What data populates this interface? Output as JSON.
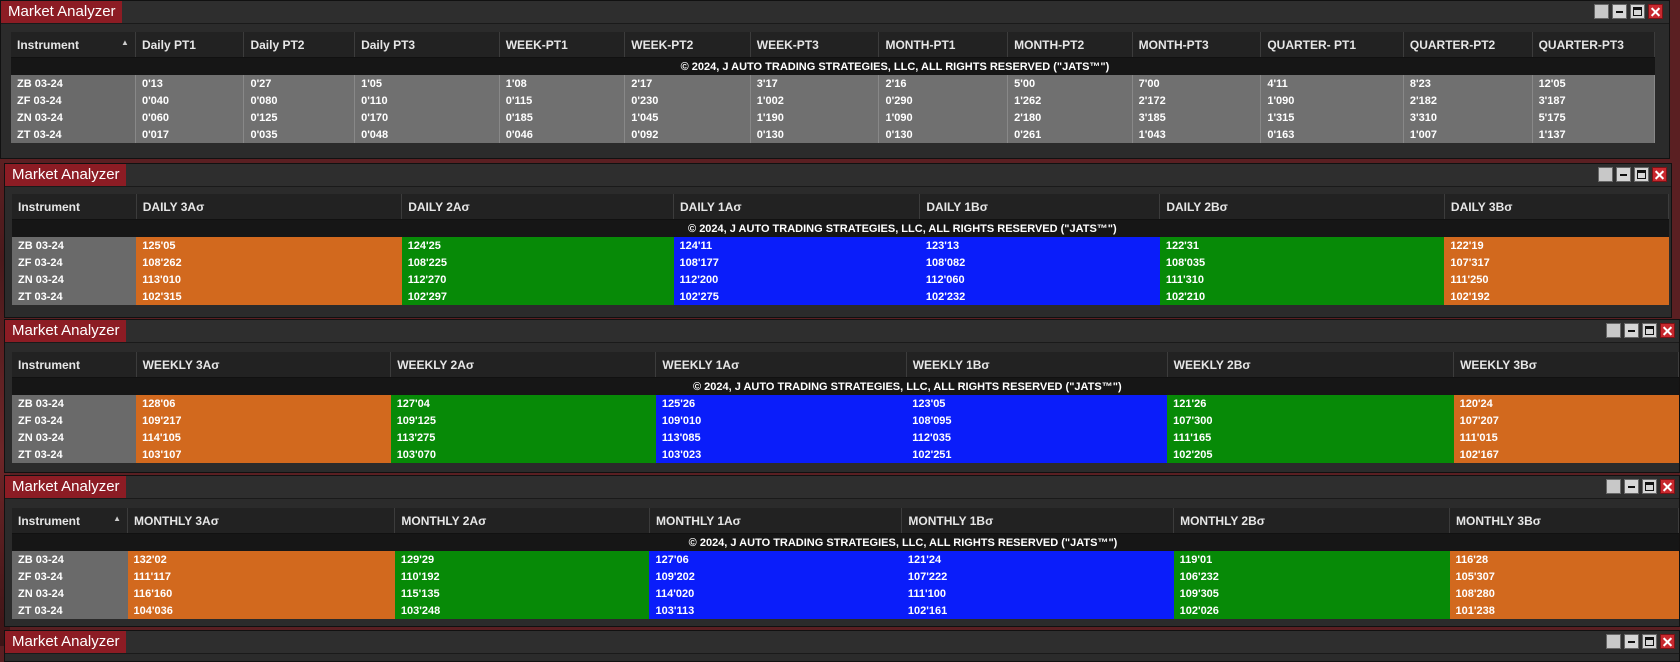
{
  "copyright": "© 2024, J AUTO TRADING STRATEGIES, LLC, ALL RIGHTS RESERVED (\"JATS™\")",
  "window_title": "Market Analyzer",
  "instrument_header": "Instrument",
  "sort_icon": "▲",
  "colors": {
    "orange": "#d2691e",
    "green": "#078a07",
    "blue": "#0a1dfa",
    "title_red": "#8c1c24"
  },
  "instruments": [
    "ZB 03-24",
    "ZF 03-24",
    "ZN 03-24",
    "ZT 03-24"
  ],
  "pt": {
    "headers": [
      "Daily PT1",
      "Daily PT2",
      "Daily PT3",
      "WEEK-PT1",
      "WEEK-PT2",
      "WEEK-PT3",
      "MONTH-PT1",
      "MONTH-PT2",
      "MONTH-PT3",
      "QUARTER- PT1",
      "QUARTER-PT2",
      "QUARTER-PT3"
    ],
    "rows": [
      [
        "0'13",
        "0'27",
        "1'05",
        "1'08",
        "2'17",
        "3'17",
        "2'16",
        "5'00",
        "7'00",
        "4'11",
        "8'23",
        "12'05"
      ],
      [
        "0'040",
        "0'080",
        "0'110",
        "0'115",
        "0'230",
        "1'002",
        "0'290",
        "1'262",
        "2'172",
        "1'090",
        "2'182",
        "3'187"
      ],
      [
        "0'060",
        "0'125",
        "0'170",
        "0'185",
        "1'045",
        "1'190",
        "1'090",
        "2'180",
        "3'185",
        "1'315",
        "3'310",
        "5'175"
      ],
      [
        "0'017",
        "0'035",
        "0'048",
        "0'046",
        "0'092",
        "0'130",
        "0'130",
        "0'261",
        "1'043",
        "0'163",
        "1'007",
        "1'137"
      ]
    ]
  },
  "daily": {
    "headers": [
      "DAILY 3Aσ",
      "DAILY 2Aσ",
      "DAILY 1Aσ",
      "DAILY 1Bσ",
      "DAILY 2Bσ",
      "DAILY 3Bσ"
    ],
    "rows": [
      [
        "125'05",
        "124'25",
        "124'11",
        "123'13",
        "122'31",
        "122'19"
      ],
      [
        "108'262",
        "108'225",
        "108'177",
        "108'082",
        "108'035",
        "107'317"
      ],
      [
        "113'010",
        "112'270",
        "112'200",
        "112'060",
        "111'310",
        "111'250"
      ],
      [
        "102'315",
        "102'297",
        "102'275",
        "102'232",
        "102'210",
        "102'192"
      ]
    ]
  },
  "weekly": {
    "headers": [
      "WEEKLY 3Aσ",
      "WEEKLY 2Aσ",
      "WEEKLY 1Aσ",
      "WEEKLY 1Bσ",
      "WEEKLY 2Bσ",
      "WEEKLY 3Bσ"
    ],
    "rows": [
      [
        "128'06",
        "127'04",
        "125'26",
        "123'05",
        "121'26",
        "120'24"
      ],
      [
        "109'217",
        "109'125",
        "109'010",
        "108'095",
        "107'300",
        "107'207"
      ],
      [
        "114'105",
        "113'275",
        "113'085",
        "112'035",
        "111'165",
        "111'015"
      ],
      [
        "103'107",
        "103'070",
        "103'023",
        "102'251",
        "102'205",
        "102'167"
      ]
    ]
  },
  "monthly": {
    "headers": [
      "MONTHLY 3Aσ",
      "MONTHLY 2Aσ",
      "MONTHLY 1Aσ",
      "MONTHLY 1Bσ",
      "MONTHLY 2Bσ",
      "MONTHLY 3Bσ"
    ],
    "rows": [
      [
        "132'02",
        "129'29",
        "127'06",
        "121'24",
        "119'01",
        "116'28"
      ],
      [
        "111'117",
        "110'192",
        "109'202",
        "107'222",
        "106'232",
        "105'307"
      ],
      [
        "116'160",
        "115'135",
        "114'020",
        "111'100",
        "109'305",
        "108'280"
      ],
      [
        "104'036",
        "103'248",
        "103'113",
        "102'161",
        "102'026",
        "101'238"
      ]
    ]
  }
}
